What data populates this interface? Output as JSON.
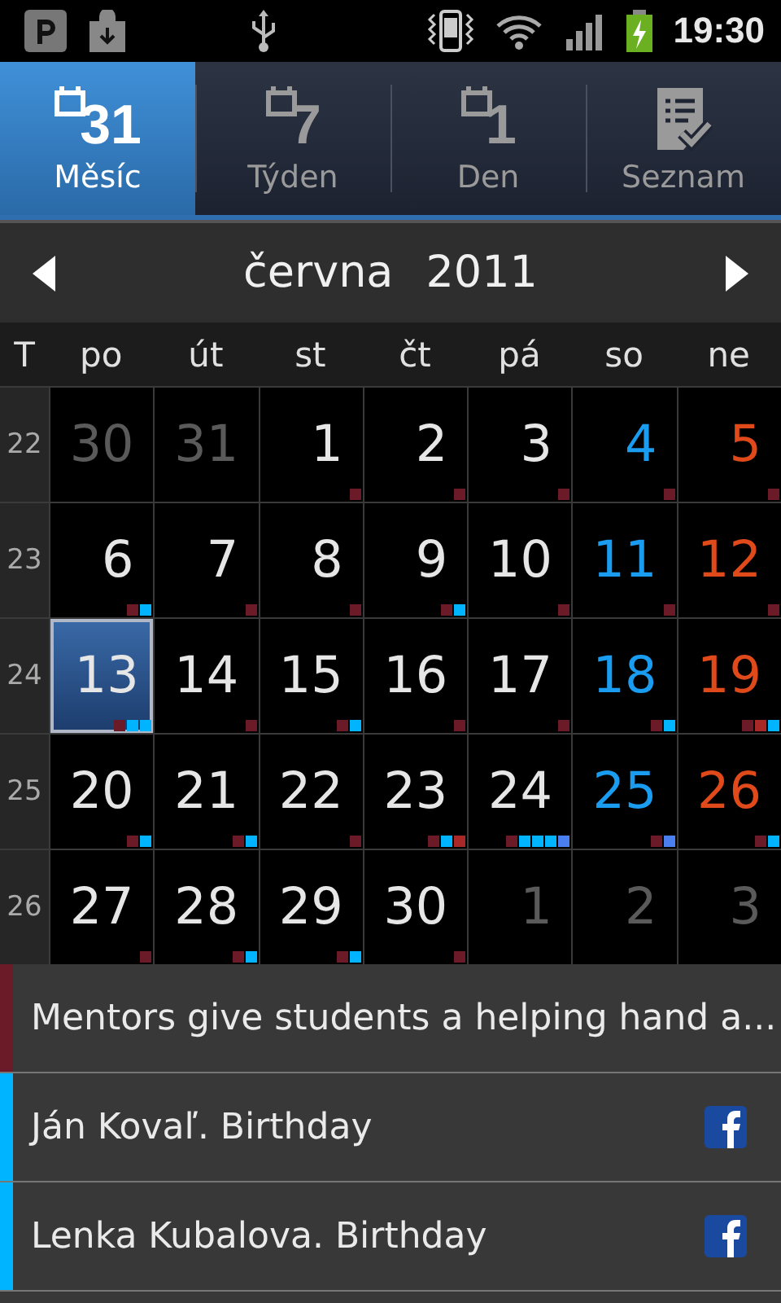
{
  "status_bar": {
    "time": "19:30"
  },
  "tabs": [
    {
      "label": "Měsíc",
      "icon_number": "31",
      "kind": "calendar",
      "selected": true
    },
    {
      "label": "Týden",
      "icon_number": "7",
      "kind": "calendar",
      "selected": false
    },
    {
      "label": "Den",
      "icon_number": "1",
      "kind": "calendar",
      "selected": false
    },
    {
      "label": "Seznam",
      "kind": "list",
      "selected": false
    }
  ],
  "month_header": {
    "month": "června",
    "year": "2011"
  },
  "weekday_header": {
    "week_label": "T",
    "days": [
      "po",
      "út",
      "st",
      "čt",
      "pá",
      "so",
      "ne"
    ]
  },
  "weeks": [
    {
      "number": "22",
      "days": [
        {
          "day": "30",
          "kind": "outside",
          "selected": false
        },
        {
          "day": "31",
          "kind": "outside",
          "selected": false
        },
        {
          "day": "1",
          "kind": "weekday",
          "selected": false,
          "dots": [
            {
              "color": "#6b1a28"
            }
          ]
        },
        {
          "day": "2",
          "kind": "weekday",
          "selected": false,
          "dots": [
            {
              "color": "#6b1a28"
            }
          ]
        },
        {
          "day": "3",
          "kind": "weekday",
          "selected": false,
          "dots": [
            {
              "color": "#6b1a28"
            }
          ]
        },
        {
          "day": "4",
          "kind": "saturday",
          "selected": false,
          "dots": [
            {
              "color": "#6b1a28"
            }
          ]
        },
        {
          "day": "5",
          "kind": "sunday",
          "selected": false,
          "dots": [
            {
              "color": "#6b1a28"
            }
          ]
        }
      ]
    },
    {
      "number": "23",
      "days": [
        {
          "day": "6",
          "kind": "weekday",
          "selected": false,
          "dots": [
            {
              "color": "#6b1a28"
            },
            {
              "color": "#00b4ff"
            }
          ]
        },
        {
          "day": "7",
          "kind": "weekday",
          "selected": false,
          "dots": [
            {
              "color": "#6b1a28"
            }
          ]
        },
        {
          "day": "8",
          "kind": "weekday",
          "selected": false,
          "dots": [
            {
              "color": "#6b1a28"
            }
          ]
        },
        {
          "day": "9",
          "kind": "weekday",
          "selected": false,
          "dots": [
            {
              "color": "#6b1a28"
            },
            {
              "color": "#00b4ff"
            }
          ]
        },
        {
          "day": "10",
          "kind": "weekday",
          "selected": false,
          "dots": [
            {
              "color": "#6b1a28"
            }
          ]
        },
        {
          "day": "11",
          "kind": "saturday",
          "selected": false,
          "dots": [
            {
              "color": "#6b1a28"
            }
          ]
        },
        {
          "day": "12",
          "kind": "sunday",
          "selected": false,
          "dots": [
            {
              "color": "#6b1a28"
            }
          ]
        }
      ]
    },
    {
      "number": "24",
      "days": [
        {
          "day": "13",
          "kind": "weekday",
          "selected": true,
          "dots": [
            {
              "color": "#6b1a28"
            },
            {
              "color": "#00b4ff"
            },
            {
              "color": "#00b4ff"
            }
          ]
        },
        {
          "day": "14",
          "kind": "weekday",
          "selected": false,
          "dots": [
            {
              "color": "#6b1a28"
            }
          ]
        },
        {
          "day": "15",
          "kind": "weekday",
          "selected": false,
          "dots": [
            {
              "color": "#6b1a28"
            },
            {
              "color": "#00b4ff"
            }
          ]
        },
        {
          "day": "16",
          "kind": "weekday",
          "selected": false,
          "dots": [
            {
              "color": "#6b1a28"
            }
          ]
        },
        {
          "day": "17",
          "kind": "weekday",
          "selected": false,
          "dots": [
            {
              "color": "#6b1a28"
            }
          ]
        },
        {
          "day": "18",
          "kind": "saturday",
          "selected": false,
          "dots": [
            {
              "color": "#6b1a28"
            },
            {
              "color": "#00b4ff"
            }
          ]
        },
        {
          "day": "19",
          "kind": "sunday",
          "selected": false,
          "dots": [
            {
              "color": "#6b1a28"
            },
            {
              "color": "#a82828"
            },
            {
              "color": "#00b4ff"
            }
          ]
        }
      ]
    },
    {
      "number": "25",
      "days": [
        {
          "day": "20",
          "kind": "weekday",
          "selected": false,
          "dots": [
            {
              "color": "#6b1a28"
            },
            {
              "color": "#00b4ff"
            }
          ]
        },
        {
          "day": "21",
          "kind": "weekday",
          "selected": false,
          "dots": [
            {
              "color": "#6b1a28"
            },
            {
              "color": "#00b4ff"
            }
          ]
        },
        {
          "day": "22",
          "kind": "weekday",
          "selected": false,
          "dots": [
            {
              "color": "#6b1a28"
            }
          ]
        },
        {
          "day": "23",
          "kind": "weekday",
          "selected": false,
          "dots": [
            {
              "color": "#6b1a28"
            },
            {
              "color": "#00b4ff"
            },
            {
              "color": "#a82828"
            }
          ]
        },
        {
          "day": "24",
          "kind": "weekday",
          "selected": false,
          "dots": [
            {
              "color": "#6b1a28"
            },
            {
              "color": "#00b4ff"
            },
            {
              "color": "#00b4ff"
            },
            {
              "color": "#00b4ff"
            },
            {
              "color": "#4a7ff0"
            }
          ]
        },
        {
          "day": "25",
          "kind": "saturday",
          "selected": false,
          "dots": [
            {
              "color": "#6b1a28"
            },
            {
              "color": "#4a7ff0"
            }
          ]
        },
        {
          "day": "26",
          "kind": "sunday",
          "selected": false,
          "dots": [
            {
              "color": "#6b1a28"
            },
            {
              "color": "#00b4ff"
            }
          ]
        }
      ]
    },
    {
      "number": "26",
      "days": [
        {
          "day": "27",
          "kind": "weekday",
          "selected": false,
          "dots": [
            {
              "color": "#6b1a28"
            }
          ]
        },
        {
          "day": "28",
          "kind": "weekday",
          "selected": false,
          "dots": [
            {
              "color": "#6b1a28"
            },
            {
              "color": "#00b4ff"
            }
          ]
        },
        {
          "day": "29",
          "kind": "weekday",
          "selected": false,
          "dots": [
            {
              "color": "#6b1a28"
            },
            {
              "color": "#00b4ff"
            }
          ]
        },
        {
          "day": "30",
          "kind": "weekday",
          "selected": false,
          "dots": [
            {
              "color": "#6b1a28"
            }
          ]
        },
        {
          "day": "1",
          "kind": "outside",
          "selected": false
        },
        {
          "day": "2",
          "kind": "outside",
          "selected": false
        },
        {
          "day": "3",
          "kind": "outside",
          "selected": false
        }
      ]
    }
  ],
  "events": [
    {
      "title": "Mentors give students a helping hand a...",
      "color": "#6b1a28",
      "facebook": false
    },
    {
      "title": "Ján Kovaľ. Birthday",
      "color": "#00b4ff",
      "facebook": true
    },
    {
      "title": "Lenka Kubalova. Birthday",
      "color": "#00b4ff",
      "facebook": true
    }
  ]
}
